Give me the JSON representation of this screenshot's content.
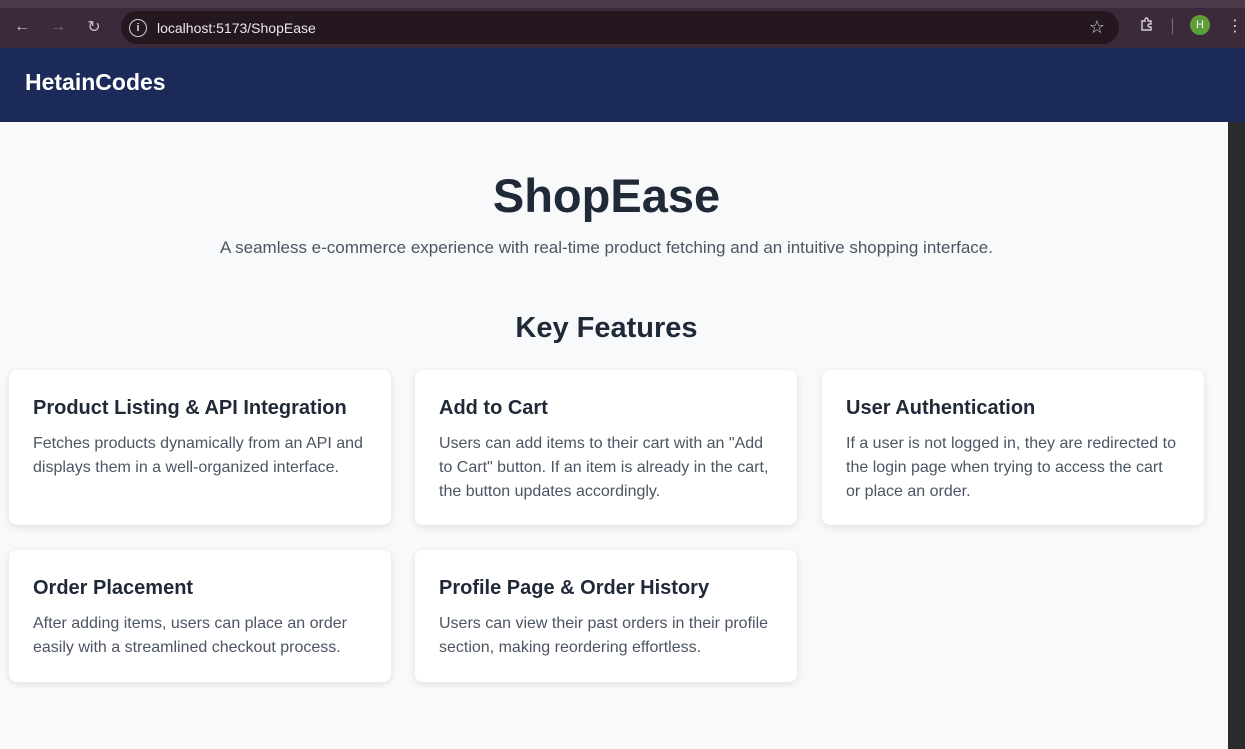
{
  "browser": {
    "url": "localhost:5173/ShopEase",
    "profile_initial": "H"
  },
  "header": {
    "brand": "HetainCodes"
  },
  "hero": {
    "title": "ShopEase",
    "subtitle": "A seamless e-commerce experience with real-time product fetching and an intuitive shopping interface."
  },
  "features": {
    "title": "Key Features",
    "items": [
      {
        "title": "Product Listing & API Integration",
        "description": "Fetches products dynamically from an API and displays them in a well-organized interface."
      },
      {
        "title": "Add to Cart",
        "description": "Users can add items to their cart with an \"Add to Cart\" button. If an item is already in the cart, the button updates accordingly."
      },
      {
        "title": "User Authentication",
        "description": "If a user is not logged in, they are redirected to the login page when trying to access the cart or place an order."
      },
      {
        "title": "Order Placement",
        "description": "After adding items, users can place an order easily with a streamlined checkout process."
      },
      {
        "title": "Profile Page & Order History",
        "description": "Users can view their past orders in their profile section, making reordering effortless."
      }
    ]
  },
  "icons": {
    "back": "arrow-left-icon",
    "forward": "arrow-right-icon",
    "reload": "reload-icon",
    "site_info": "info-icon",
    "bookmark": "star-icon",
    "extensions": "puzzle-icon",
    "menu": "kebab-menu-icon"
  },
  "colors": {
    "header_bg": "#1b2a58",
    "page_bg": "#f8f9fb",
    "text_primary": "#1f2937",
    "text_secondary": "#4b5563",
    "avatar": "#5d9d3a"
  }
}
